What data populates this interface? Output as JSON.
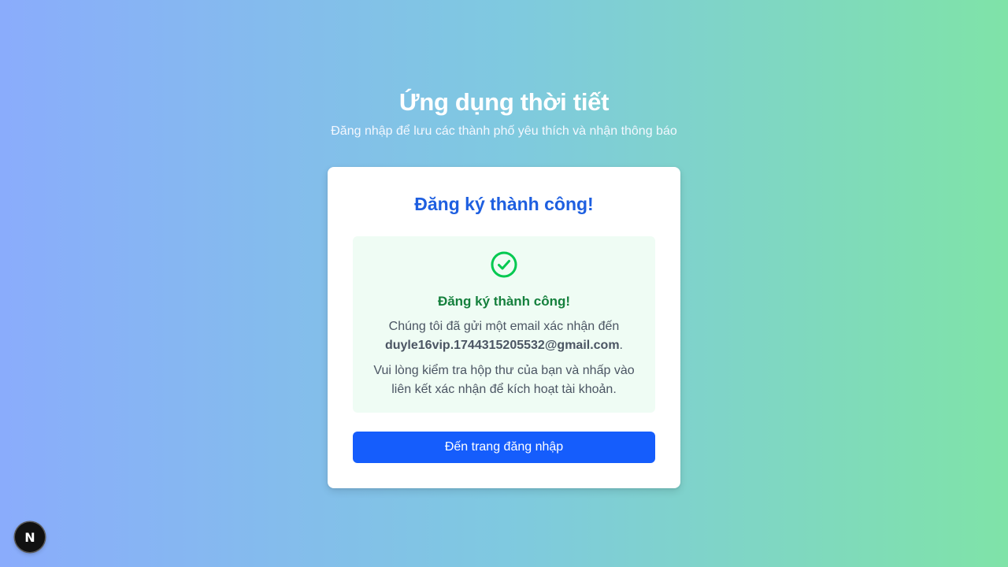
{
  "header": {
    "title": "Ứng dụng thời tiết",
    "subtitle": "Đăng nhập để lưu các thành phố yêu thích và nhận thông báo"
  },
  "card": {
    "title": "Đăng ký thành công!",
    "success": {
      "icon": "check-circle-icon",
      "title": "Đăng ký thành công!",
      "message_prefix": "Chúng tôi đã gửi một email xác nhận đến",
      "email": "duyle16vip.1744315205532@gmail.com",
      "message_suffix": ".",
      "instruction": "Vui lòng kiểm tra hộp thư của bạn và nhấp vào liên kết xác nhận để kích hoạt tài khoản."
    },
    "button_label": "Đến trang đăng nhập"
  },
  "dev_badge": {
    "label": "N"
  },
  "colors": {
    "gradient_start": "#8aacfc",
    "gradient_end": "#7fe3a8",
    "primary": "#155dfc",
    "title_blue": "#1e5fe0",
    "success_green": "#15803d",
    "check_green": "#00c950",
    "success_bg": "#effcf4"
  }
}
